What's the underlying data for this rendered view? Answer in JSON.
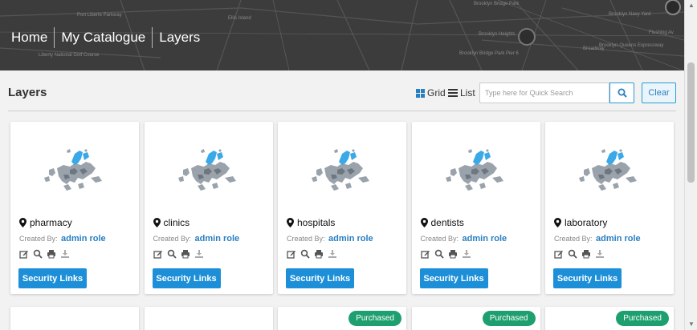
{
  "breadcrumb": {
    "items": [
      {
        "label": "Home"
      },
      {
        "label": "My Catalogue"
      },
      {
        "label": "Layers"
      }
    ]
  },
  "toolbar": {
    "title": "Layers",
    "grid_label": "Grid",
    "list_label": "List",
    "search_placeholder": "Type here for Quick Search",
    "clear_label": "Clear"
  },
  "map_labels": {
    "l1": "Ellis Island",
    "l2": "Brooklyn Bridge Park",
    "l3": "Brooklyn Navy Yard",
    "l4": "Liberty National Golf Course",
    "l5": "Flushing Av",
    "l6": "Brooklyn Heights",
    "l7": "Brooklyn Bridge Park Pier 6",
    "l8": "Broadway",
    "l9": "Brooklyn-Queens Expressway",
    "l10": "Port Liberte Parkway"
  },
  "cards": [
    {
      "name": "pharmacy",
      "created_label": "Created By:",
      "author": "admin role",
      "button": "Security Links"
    },
    {
      "name": "clinics",
      "created_label": "Created By:",
      "author": "admin role",
      "button": "Security Links"
    },
    {
      "name": "hospitals",
      "created_label": "Created By:",
      "author": "admin role",
      "button": "Security Links"
    },
    {
      "name": "dentists",
      "created_label": "Created By:",
      "author": "admin role",
      "button": "Security Links"
    },
    {
      "name": "laboratory",
      "created_label": "Created By:",
      "author": "admin role",
      "button": "Security Links"
    }
  ],
  "second_row": {
    "badges": [
      "Purchased",
      "Purchased",
      "Purchased"
    ]
  },
  "colors": {
    "accent": "#1d8fd8",
    "badge": "#1e9f6f",
    "header": "#3c3c3c"
  },
  "icons": [
    "map-marker-icon",
    "edit-icon",
    "search-icon",
    "print-icon",
    "download-icon",
    "grid-icon",
    "list-icon"
  ]
}
